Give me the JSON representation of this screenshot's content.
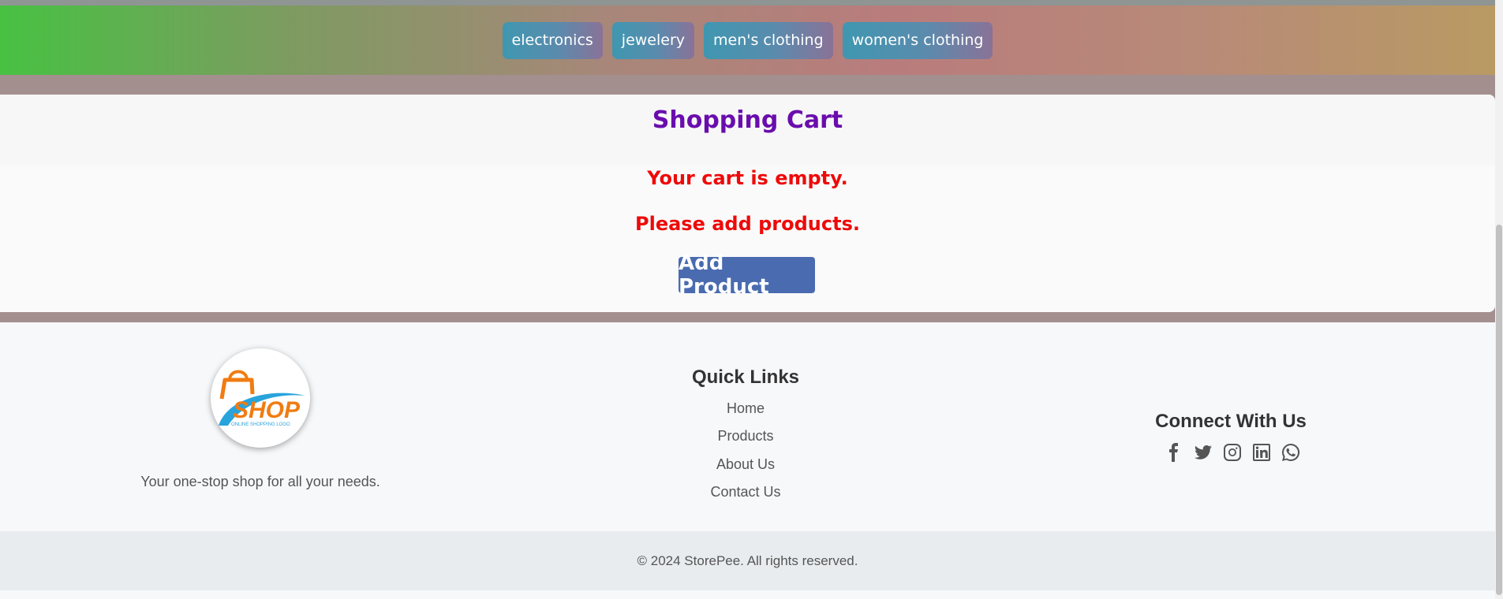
{
  "categories": [
    "electronics",
    "jewelery",
    "men's clothing",
    "women's clothing"
  ],
  "cart": {
    "title": "Shopping Cart",
    "empty_message": "Your cart is empty.",
    "prompt_message": "Please add products.",
    "add_button": "Add Product"
  },
  "footer": {
    "logo_text": "SHOP",
    "logo_subtext": "ONLINE SHOPPING LOGO",
    "tagline": "Your one-stop shop for all your needs.",
    "quick_links_title": "Quick Links",
    "quick_links": [
      "Home",
      "Products",
      "About Us",
      "Contact Us"
    ],
    "connect_title": "Connect With Us",
    "social_icons": [
      "facebook-icon",
      "twitter-icon",
      "instagram-icon",
      "linkedin-icon",
      "whatsapp-icon"
    ],
    "copyright": "© 2024 StorePee. All rights reserved."
  },
  "colors": {
    "title_purple": "#6a0dad",
    "empty_red": "#ee0a0a",
    "button_blue": "#4a6bb0",
    "logo_orange": "#f07c12",
    "logo_blue": "#29a3db"
  }
}
